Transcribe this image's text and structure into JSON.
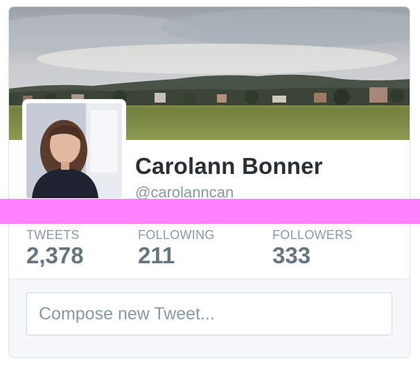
{
  "profile": {
    "name": "Carolann Bonner",
    "handle": "@carolanncan"
  },
  "stats": [
    {
      "label": "TWEETS",
      "value": "2,378"
    },
    {
      "label": "FOLLOWING",
      "value": "211"
    },
    {
      "label": "FOLLOWERS",
      "value": "333"
    }
  ],
  "compose": {
    "placeholder": "Compose new Tweet..."
  },
  "colors": {
    "name_text": "#292f33",
    "muted_text": "#8899a6",
    "stat_value": "#66757f",
    "compose_background": "#f5f8fa",
    "highlight_band": "#ff80ff"
  }
}
